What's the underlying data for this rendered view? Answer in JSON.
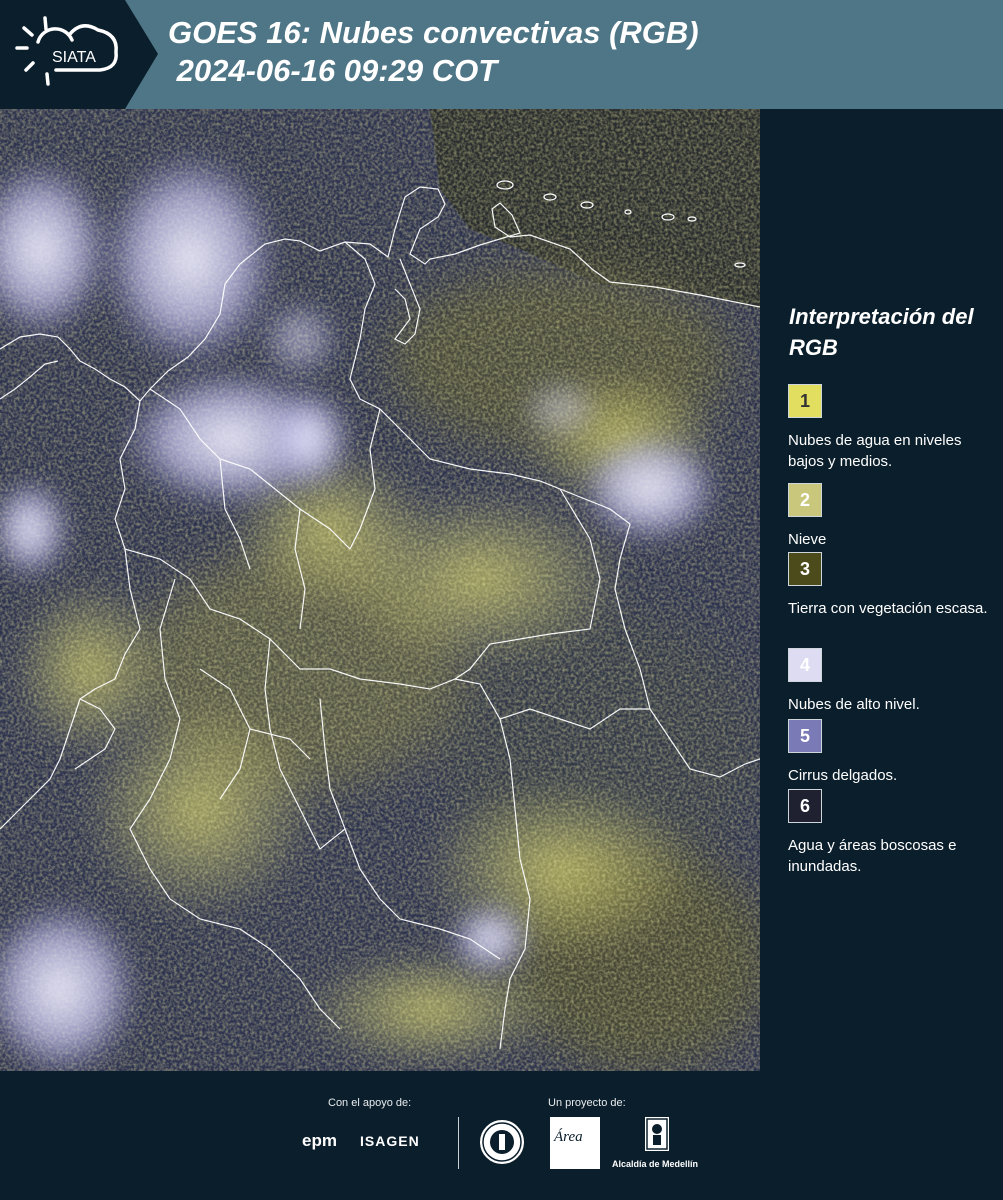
{
  "header": {
    "logo_text": "SIATA",
    "title": "GOES 16: Nubes convectivas (RGB)\n 2024-06-16 09:29 COT"
  },
  "map": {
    "description_icon": "satellite-rgb-image"
  },
  "legend": {
    "title": "Interpretación del RGB",
    "items": [
      {
        "number": "1",
        "label": "Nubes de agua en niveles bajos y medios.",
        "color": "#e2df60",
        "text_color": "#333333"
      },
      {
        "number": "2",
        "label": "Nieve",
        "color": "#c8c77c",
        "text_color": "#ffffff"
      },
      {
        "number": "3",
        "label": "Tierra con vegetación escasa.",
        "color": "#4c4b1c",
        "text_color": "#ffffff"
      },
      {
        "number": "4",
        "label": "Nubes de alto nivel.",
        "color": "#dedcf2",
        "text_color": "#ffffff"
      },
      {
        "number": "5",
        "label": "Cirrus delgados.",
        "color": "#7a7ab6",
        "text_color": "#ffffff"
      },
      {
        "number": "6",
        "label": "Agua y áreas boscosas e inundadas.",
        "color": "#1f2130",
        "text_color": "#ffffff"
      }
    ]
  },
  "footer": {
    "support_label": "Con el apoyo de:",
    "project_label": "Un proyecto de:",
    "sponsors": [
      "epm",
      "ISAGEN"
    ],
    "area_logo_text": "Área",
    "alcaldia_text": "Alcaldía de Medellín"
  }
}
